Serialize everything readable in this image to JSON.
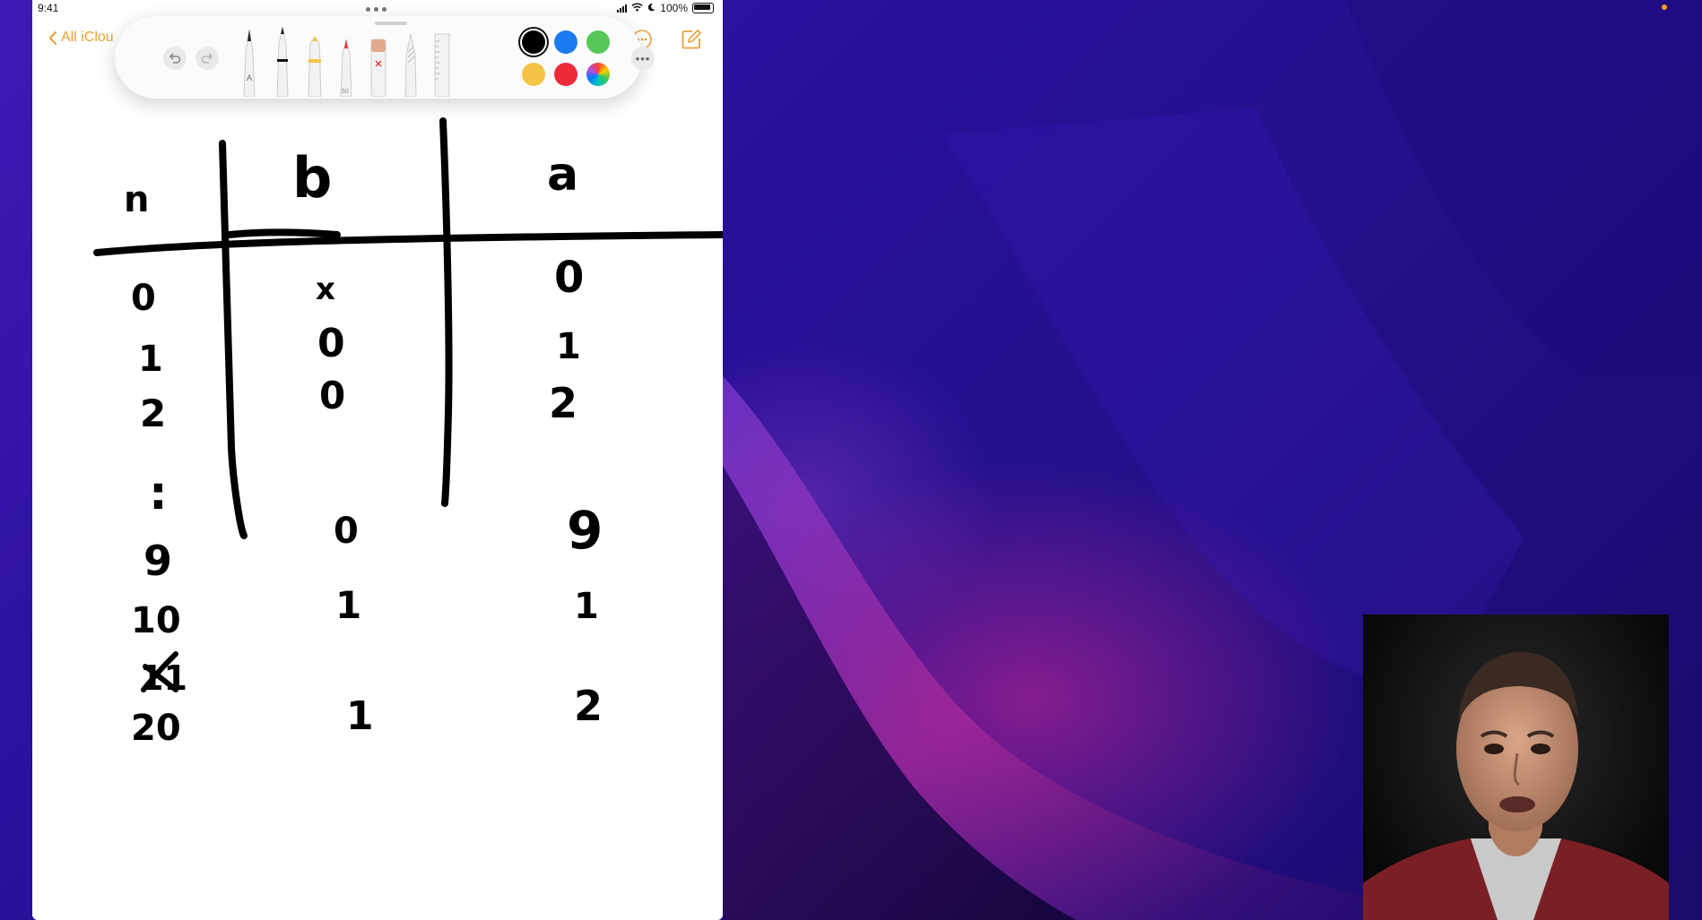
{
  "status_bar": {
    "time": "9:41",
    "battery": "100%"
  },
  "nav": {
    "back_label": "All iClou"
  },
  "toolbar": {
    "undo_icon": "undo-icon",
    "redo_icon": "redo-icon",
    "tools": [
      "pen-A",
      "monoline-pen",
      "highlighter",
      "marker",
      "eraser",
      "pencil",
      "ruler"
    ],
    "swatches": [
      {
        "name": "black",
        "color": "#000000",
        "selected": true
      },
      {
        "name": "blue",
        "color": "#1a7cf0"
      },
      {
        "name": "green",
        "color": "#56c85a"
      },
      {
        "name": "yellow",
        "color": "#f5c445"
      },
      {
        "name": "red",
        "color": "#ee2a3a"
      },
      {
        "name": "multicolor",
        "color": "conic"
      }
    ],
    "more_icon": "ellipsis-icon"
  },
  "note": {
    "headers": [
      "n",
      "b",
      "a"
    ],
    "rows": [
      {
        "n": "0",
        "b": "x",
        "a": "0"
      },
      {
        "n": "1",
        "b": "0",
        "a": "1"
      },
      {
        "n": "2",
        "b": "0",
        "a": "2"
      },
      {
        "n": ":",
        "b": "",
        "a": ""
      },
      {
        "n": "9",
        "b": "0",
        "a": "9"
      },
      {
        "n": "10",
        "b": "1",
        "a": "1"
      },
      {
        "n": "11",
        "b": "",
        "a": "",
        "crossed_out": true
      },
      {
        "n": "20",
        "b": "1",
        "a": "2"
      }
    ]
  },
  "colors": {
    "accent": "#e8a33a",
    "wallpaper_primary": "#2a0f9a",
    "wallpaper_highlight": "#d6289a"
  }
}
